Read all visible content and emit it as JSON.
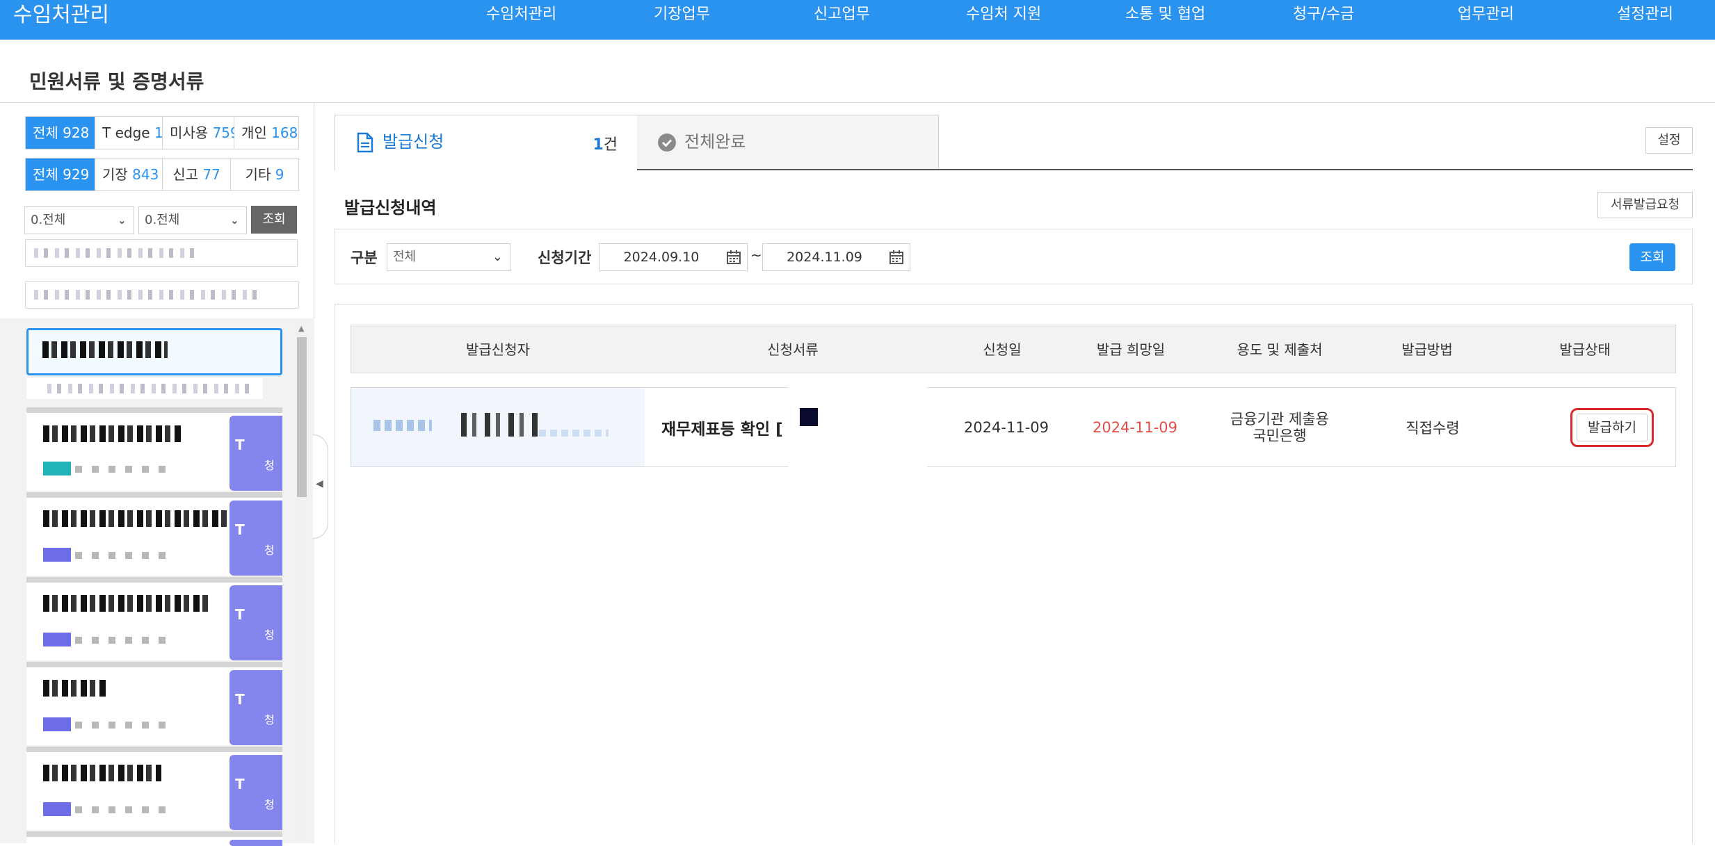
{
  "topbar": {
    "brand": "수임처관리",
    "menu": [
      "수임처관리",
      "기장업무",
      "신고업무",
      "수임처 지원",
      "소통 및 협업",
      "청구/수금",
      "업무관리",
      "설정관리"
    ]
  },
  "page": {
    "title": "민원서류 및 증명서류"
  },
  "left": {
    "row1": [
      {
        "label": "전체",
        "count": "928"
      },
      {
        "label": "T edge",
        "count": "1"
      },
      {
        "label": "미사용",
        "count": "759"
      },
      {
        "label": "개인",
        "count": "168"
      }
    ],
    "row2": [
      {
        "label": "전체",
        "count": "929"
      },
      {
        "label": "기장",
        "count": "843"
      },
      {
        "label": "신고",
        "count": "77"
      },
      {
        "label": "기타",
        "count": "9"
      }
    ],
    "select1": "0.전체",
    "select2": "0.전체",
    "search_button": "조회",
    "card_badge": "청"
  },
  "tabs": [
    {
      "label": "발급신청",
      "count": "1",
      "unit": "건"
    },
    {
      "label": "전체완료"
    }
  ],
  "settings_button": "설정",
  "section": {
    "title": "발급신청내역",
    "request_button": "서류발급요청"
  },
  "filter": {
    "type_label": "구분",
    "type_value": "전체",
    "period_label": "신청기간",
    "date_from": "2024.09.10",
    "date_to": "2024.11.09",
    "tilde": "~",
    "search_button": "조회"
  },
  "table": {
    "headers": [
      "발급신청자",
      "신청서류",
      "신청일",
      "발급 희망일",
      "용도 및 제출처",
      "발급방법",
      "발급상태"
    ],
    "rows": [
      {
        "document": "재무제표등 확인 [",
        "request_date": "2024-11-09",
        "desired_date": "2024-11-09",
        "purpose_line1": "금융기관 제출용",
        "purpose_line2": "국민은행",
        "method": "직접수령",
        "action": "발급하기"
      }
    ]
  },
  "colors": {
    "primary": "#2a93f0",
    "badge": "#8585ee",
    "alert": "#e0504a"
  }
}
